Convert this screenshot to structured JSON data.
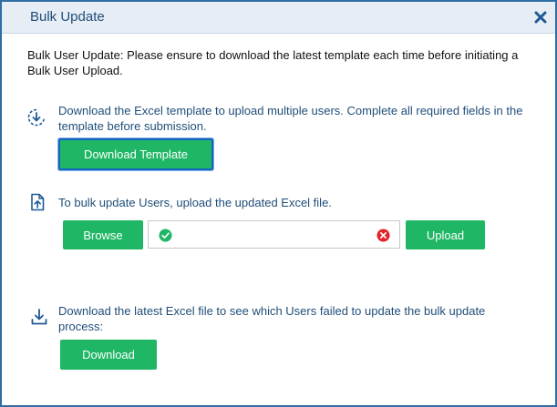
{
  "dialog": {
    "title": "Bulk Update",
    "close_icon": "close-icon"
  },
  "intro": {
    "text": "Bulk User Update: Please ensure to download the latest template each time before initiating a Bulk User Upload."
  },
  "template_section": {
    "icon": "download-circle-icon",
    "text": "Download the Excel template to upload multiple users. Complete all required fields in the template before submission.",
    "button_label": "Download Template"
  },
  "upload_section": {
    "icon": "file-upload-icon",
    "text": "To bulk update Users, upload the updated Excel file.",
    "browse_label": "Browse",
    "file_value": "",
    "upload_label": "Upload"
  },
  "failed_section": {
    "icon": "download-icon",
    "text": "Download the latest Excel file to see which Users failed to update the bulk update process:",
    "button_label": "Download"
  },
  "colors": {
    "primary": "#1fb765",
    "heading": "#1f4e79",
    "border": "#2f6ea5",
    "error": "#e0242b"
  }
}
